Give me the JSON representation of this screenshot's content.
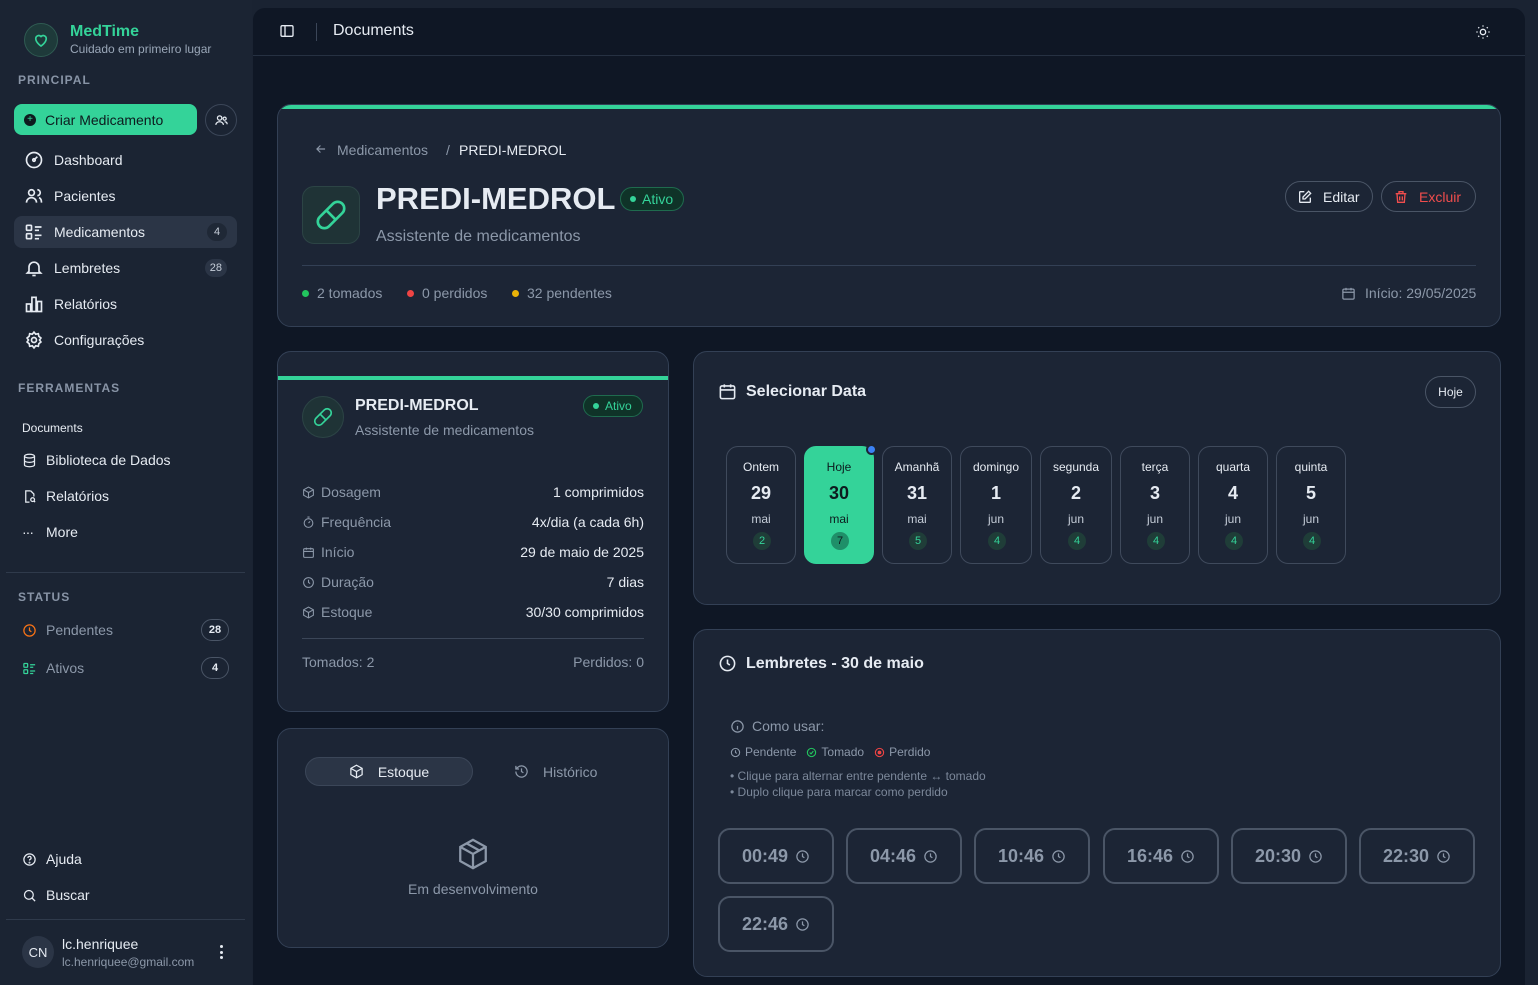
{
  "brand": {
    "name": "MedTime",
    "tagline": "Cuidado em primeiro lugar"
  },
  "sidebar": {
    "principal_title": "PRINCIPAL",
    "create_label": "Criar Medicamento",
    "nav": [
      {
        "label": "Dashboard",
        "icon": "dashboard-icon"
      },
      {
        "label": "Pacientes",
        "icon": "users-icon"
      },
      {
        "label": "Medicamentos",
        "icon": "list-icon",
        "badge": "4",
        "active": true
      },
      {
        "label": "Lembretes",
        "icon": "bell-icon",
        "badge": "28"
      },
      {
        "label": "Relatórios",
        "icon": "bar-chart-icon"
      },
      {
        "label": "Configurações",
        "icon": "gear-icon"
      }
    ],
    "tools_title": "FERRAMENTAS",
    "tools_sub": "Documents",
    "tools": [
      {
        "label": "Biblioteca de Dados",
        "icon": "database-icon"
      },
      {
        "label": "Relatórios",
        "icon": "report-icon"
      },
      {
        "label": "More",
        "icon": "more-icon"
      }
    ],
    "status_title": "STATUS",
    "status": [
      {
        "label": "Pendentes",
        "badge": "28",
        "color": "#f97316"
      },
      {
        "label": "Ativos",
        "badge": "4",
        "color": "#34d399"
      }
    ],
    "help_label": "Ajuda",
    "search_label": "Buscar",
    "user": {
      "initials": "CN",
      "name": "lc.henriquee",
      "email": "lc.henriquee@gmail.com"
    }
  },
  "topbar": {
    "title": "Documents"
  },
  "header": {
    "breadcrumb_parent": "Medicamentos",
    "breadcrumb_sep": "/",
    "breadcrumb_current": "PREDI-MEDROL",
    "title": "PREDI-MEDROL",
    "status": "Ativo",
    "subtitle": "Assistente de medicamentos",
    "edit_label": "Editar",
    "delete_label": "Excluir",
    "stats": [
      {
        "label": "2 tomados",
        "color": "#22c55e"
      },
      {
        "label": "0 perdidos",
        "color": "#ef4444"
      },
      {
        "label": "32 pendentes",
        "color": "#eab308"
      }
    ],
    "start_label": "Início: 29/05/2025"
  },
  "med_card": {
    "title": "PREDI-MEDROL",
    "status": "Ativo",
    "subtitle": "Assistente de medicamentos",
    "rows": [
      {
        "label": "Dosagem",
        "value": "1 comprimidos",
        "icon": "package-icon"
      },
      {
        "label": "Frequência",
        "value": "4x/dia (a cada 6h)",
        "icon": "timer-icon"
      },
      {
        "label": "Início",
        "value": "29 de maio de 2025",
        "icon": "calendar-icon"
      },
      {
        "label": "Duração",
        "value": "7 dias",
        "icon": "clock-icon"
      },
      {
        "label": "Estoque",
        "value": "30/30 comprimidos",
        "icon": "package-icon"
      }
    ],
    "taken": "Tomados: 2",
    "missed": "Perdidos: 0"
  },
  "stock_card": {
    "tab_stock": "Estoque",
    "tab_history": "Histórico",
    "empty_text": "Em desenvolvimento"
  },
  "date_card": {
    "title": "Selecionar Data",
    "today_label": "Hoje",
    "days": [
      {
        "name": "Ontem",
        "num": "29",
        "month": "mai",
        "count": "2"
      },
      {
        "name": "Hoje",
        "num": "30",
        "month": "mai",
        "count": "7",
        "selected": true
      },
      {
        "name": "Amanhã",
        "num": "31",
        "month": "mai",
        "count": "5"
      },
      {
        "name": "domingo",
        "num": "1",
        "month": "jun",
        "count": "4"
      },
      {
        "name": "segunda",
        "num": "2",
        "month": "jun",
        "count": "4"
      },
      {
        "name": "terça",
        "num": "3",
        "month": "jun",
        "count": "4"
      },
      {
        "name": "quarta",
        "num": "4",
        "month": "jun",
        "count": "4"
      },
      {
        "name": "quinta",
        "num": "5",
        "month": "jun",
        "count": "4"
      }
    ]
  },
  "reminders": {
    "title": "Lembretes - 30 de maio",
    "howto": "Como usar:",
    "legend": [
      {
        "label": "Pendente",
        "color": "#8c98a9"
      },
      {
        "label": "Tomado",
        "color": "#22c55e"
      },
      {
        "label": "Perdido",
        "color": "#ef4444"
      }
    ],
    "hint1": "• Clique para alternar entre pendente ↔ tomado",
    "hint2": "• Duplo clique para marcar como perdido",
    "times": [
      "00:49",
      "04:46",
      "10:46",
      "16:46",
      "20:30",
      "22:30",
      "22:46"
    ]
  },
  "colors": {
    "accent": "#34d399",
    "danger": "#f04d4d",
    "sidebar_bg": "#1b2433",
    "main_bg": "#0f1725",
    "card_bg": "#1c2535"
  }
}
